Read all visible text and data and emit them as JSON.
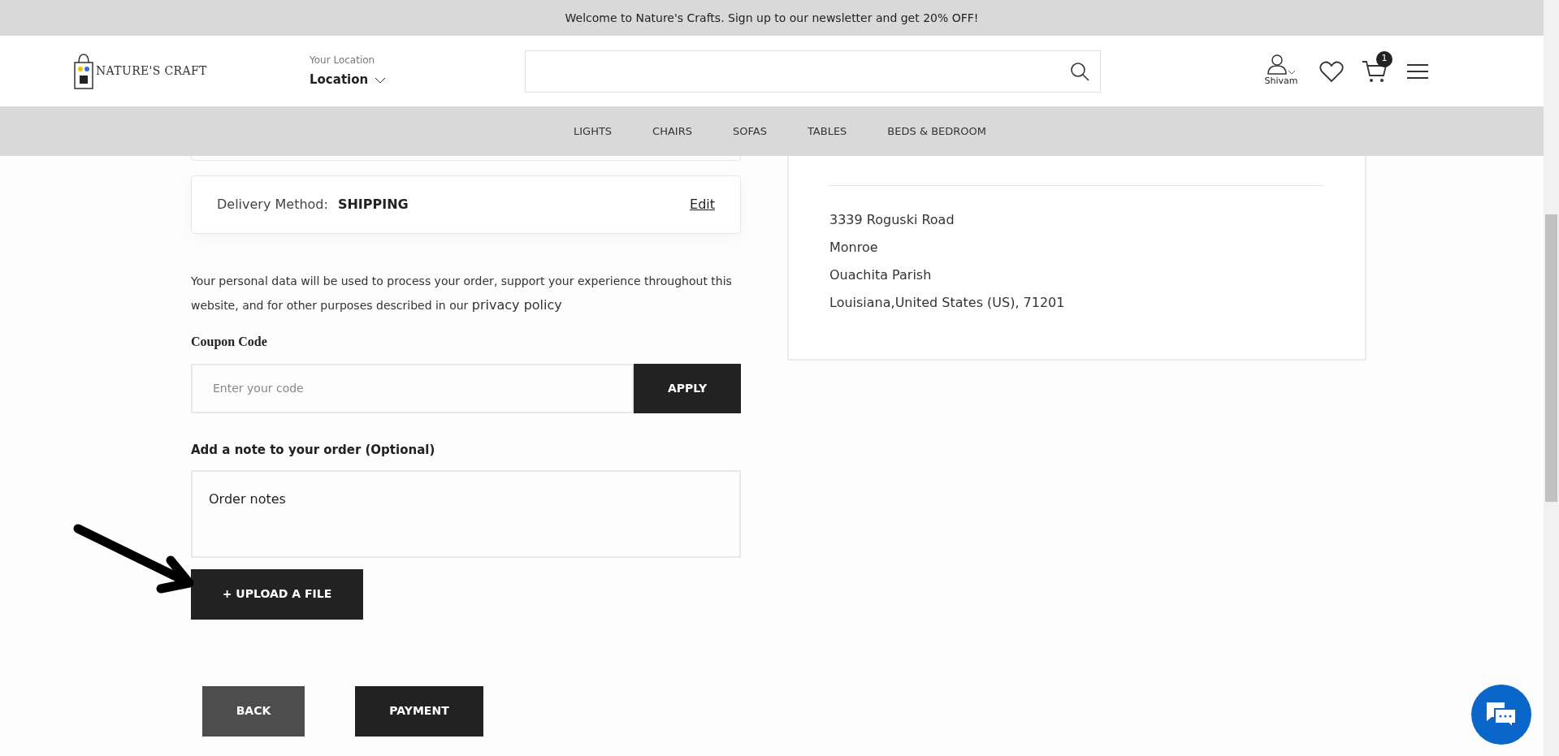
{
  "announcement": "Welcome to Nature's Crafts. Sign up to our newsletter and get 20% OFF!",
  "header": {
    "logo_text": "NATURE'S CRAFT",
    "location_label": "Your Location",
    "location_value": "Location",
    "user_name": "Shivam",
    "cart_count": "1"
  },
  "nav": [
    "LIGHTS",
    "CHAIRS",
    "SOFAS",
    "TABLES",
    "BEDS & BEDROOM"
  ],
  "delivery": {
    "label": "Delivery Method:",
    "value": "SHIPPING",
    "edit": "Edit"
  },
  "privacy": {
    "text": "Your personal data will be used to process your order, support your experience throughout this website, and for other purposes described in our",
    "link": "privacy policy"
  },
  "coupon": {
    "label": "Coupon Code",
    "placeholder": "Enter your code",
    "button": "APPLY"
  },
  "note": {
    "label": "Add a note to your order (Optional)",
    "value": "Order notes"
  },
  "upload_button": "+ UPLOAD A FILE",
  "back_button": "BACK",
  "payment_button": "PAYMENT",
  "address": [
    "3339 Roguski Road",
    "Monroe",
    "Ouachita Parish",
    "Louisiana,United States (US), 71201"
  ]
}
